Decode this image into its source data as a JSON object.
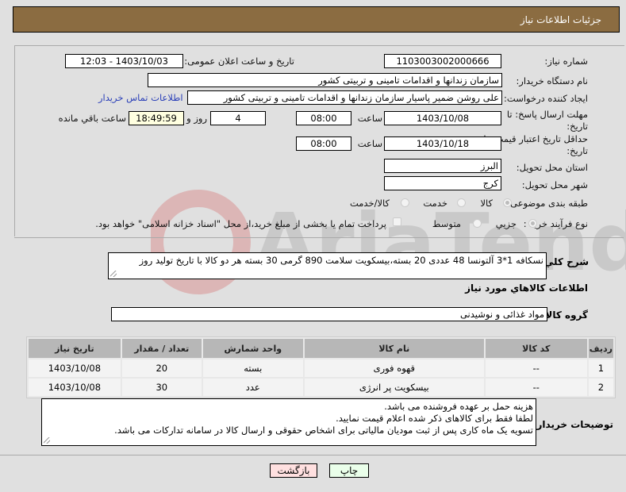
{
  "header": {
    "title": "جزئیات اطلاعات نیاز"
  },
  "fields": {
    "need_number_label": "شماره نیاز:",
    "need_number": "1103003002000666",
    "announce_label": "تاریخ و ساعت اعلان عمومی:",
    "announce_value": "1403/10/03 - 12:03",
    "buyer_org_label": "نام دستگاه خریدار:",
    "buyer_org": "سازمان زندانها و اقدامات تامینی و تربیتی کشور",
    "creator_label": "ایجاد کننده درخواست:",
    "creator": "علی روشن ضمیر پاسیار سازمان زندانها و اقدامات تامینی و تربیتی کشور",
    "contact_link": "اطلاعات تماس خریدار",
    "deadline_label_1": "مهلت ارسال پاسخ: تا",
    "deadline_label_2": "تاریخ:",
    "deadline_date": "1403/10/08",
    "time_label": "ساعت",
    "deadline_time": "08:00",
    "days_value": "4",
    "days_label": "روز و",
    "remaining_time": "18:49:59",
    "remaining_label": "ساعت باقي مانده",
    "validity_label_1": "حداقل تاریخ اعتبار قیمت: تا",
    "validity_label_2": "تاریخ:",
    "validity_date": "1403/10/18",
    "validity_time": "08:00",
    "province_label": "استان محل تحویل:",
    "province": "البرز",
    "city_label": "شهر محل تحویل:",
    "city": "کرج",
    "category_label": "طبقه بندی موضوعی:",
    "category_options": [
      "کالا",
      "خدمت",
      "کالا/خدمت"
    ],
    "category_selected": "کالا",
    "process_label": "نوع فرآیند خرید :",
    "process_options": [
      "جزیي",
      "متوسط"
    ],
    "process_selected": "جزیي",
    "payment_note": "پرداخت تمام یا بخشی از مبلغ خرید،از محل \"اسناد خزانه اسلامی\" خواهد بود."
  },
  "description": {
    "label": "شرح کلي نیاز:",
    "value": "نسکافه 1*3 آلتونسا 48 عددی 20 بسته،بیسکویت سلامت 890 گرمی 30 بسته هر دو کالا با تاریخ تولید روز"
  },
  "goods_section": {
    "title": "اطلاعات کالاهاي مورد نیاز",
    "group_label": "گروه کالا:",
    "group_value": "مواد غذائی و نوشیدنی"
  },
  "table": {
    "headers": [
      "ردیف",
      "کد کالا",
      "نام کالا",
      "واحد شمارش",
      "تعداد / مقدار",
      "تاریخ نیاز"
    ],
    "rows": [
      {
        "row": "1",
        "code": "--",
        "name": "قهوه فوری",
        "unit": "بسته",
        "qty": "20",
        "date": "1403/10/08"
      },
      {
        "row": "2",
        "code": "--",
        "name": "بیسکویت پر انرژی",
        "unit": "عدد",
        "qty": "30",
        "date": "1403/10/08"
      }
    ]
  },
  "buyer_notes": {
    "label": "توضیحات خریدار:",
    "lines": [
      "هزینه حمل بر عهده فروشنده می باشد.",
      "لطفا فقط برای کالاهای ذکر شده اعلام قیمت نمایید.",
      "تسویه یک ماه کاری پس از ثبت مودیان مالیاتی برای اشخاص حقوقی و ارسال کالا در سامانه تدارکات می باشد."
    ]
  },
  "buttons": {
    "print": "چاپ",
    "back": "بازگشت"
  },
  "colors": {
    "header_bg": "#8b6c41",
    "print_bg": "#eaffea",
    "back_bg": "#ffe0e0",
    "link": "#2a3fb8",
    "remaining_bg": "#ffffe0"
  }
}
